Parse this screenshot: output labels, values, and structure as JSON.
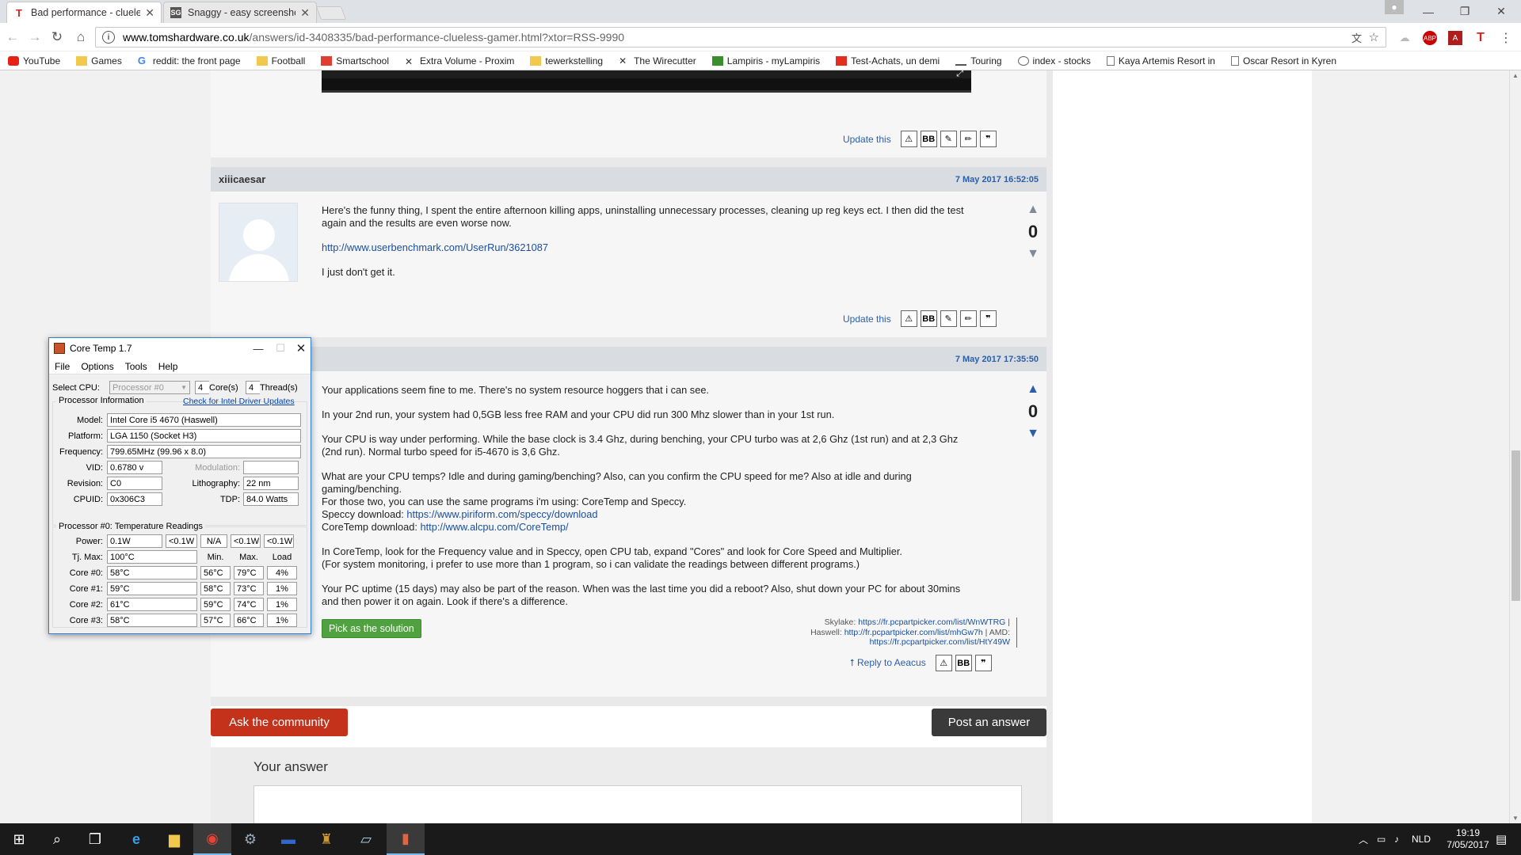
{
  "browser": {
    "tabs": [
      {
        "title": "Bad performance - clueless",
        "favicon": "T",
        "active": true
      },
      {
        "title": "Snaggy - easy screenshot",
        "favicon": "SG",
        "active": false
      }
    ],
    "url_host": "www.tomshardware.co.uk",
    "url_path": "/answers/id-3408335/bad-performance-clueless-gamer.html?xtor=RSS-9990",
    "bookmarks": [
      "YouTube",
      "Games",
      "reddit: the front page",
      "Football",
      "Smartschool",
      "Extra Volume - Proxim",
      "tewerkstelling",
      "The Wirecutter",
      "Lampiris - myLampiris",
      "Test-Achats, un demi",
      "Touring",
      "index - stocks",
      "Kaya Artemis Resort in",
      "Oscar Resort in Kyren"
    ]
  },
  "posts": {
    "first_actions": {
      "update": "Update this",
      "bb": "BB"
    },
    "xiiicaesar": {
      "user": "xiiicaesar",
      "date": "7 May 2017 16:52:05",
      "p1": "Here's the funny thing, I spent the entire afternoon killing apps, uninstalling unnecessary processes, cleaning up reg keys ect. I then did the test again and the results are even worse now.",
      "link": "http://www.userbenchmark.com/UserRun/3621087",
      "p3": "I just don't get it.",
      "votes": "0",
      "update": "Update this",
      "bb": "BB"
    },
    "aeacus": {
      "date": "7 May 2017 17:35:50",
      "p1": "Your applications seem fine to me. There's no system resource hoggers that i can see.",
      "p2": "In your 2nd run, your system had 0,5GB less free RAM and your CPU did run 300 Mhz slower than in your 1st run.",
      "p3": "Your CPU is way under performing. While the base clock is 3.4 Ghz, during benching, your CPU turbo was at 2,6 Ghz (1st run) and at 2,3 Ghz (2nd run). Normal turbo speed for i5-4670 is 3,6 Ghz.",
      "p4a": "What are your CPU temps? Idle and during gaming/benching? Also, can you confirm the CPU speed for me? Also at idle and during gaming/benching.",
      "p4b": "For those two, you can use the same programs i'm using: CoreTemp and Speccy.",
      "p4c": "Speccy download: ",
      "speccy_link": "https://www.piriform.com/speccy/download",
      "p4d": "CoreTemp download: ",
      "coretemp_link": "http://www.alcpu.com/CoreTemp/",
      "p5a": "In CoreTemp, look for the Frequency value and in Speccy, open CPU tab, expand \"Cores\" and look for Core Speed and Multiplier.",
      "p5b": "(For system monitoring, i prefer to use more than 1 program, so i can validate the readings between different programs.)",
      "p6": "Your PC uptime (15 days) may also be part of the reason. When was the last time you did a reboot? Also, shut down your PC for about 30mins and then power it on again. Look if there's a difference.",
      "votes": "0",
      "pick": "Pick as the solution",
      "sig_skylake_label": "Skylake: ",
      "sig_skylake": "https://fr.pcpartpicker.com/list/WnWTRG",
      "sig_haswell_label": "Haswell: ",
      "sig_haswell": "http://fr.pcpartpicker.com/list/mhGw7h",
      "sig_amd_label": " | AMD:",
      "sig_amd": "https://fr.pcpartpicker.com/list/HtY49W",
      "reply": "Reply to Aeacus",
      "bb": "BB"
    }
  },
  "buttons": {
    "ask": "Ask the community",
    "post": "Post an answer",
    "your_answer": "Your answer"
  },
  "coretemp": {
    "title": "Core Temp 1.7",
    "menu": [
      "File",
      "Options",
      "Tools",
      "Help"
    ],
    "select_cpu_label": "Select CPU:",
    "select_cpu": "Processor #0",
    "cores": "4",
    "cores_label": "Core(s)",
    "threads": "4",
    "threads_label": "Thread(s)",
    "proc_info": "Processor Information",
    "driver_link": "Check for Intel Driver Updates",
    "model_label": "Model:",
    "model": "Intel Core i5 4670 (Haswell)",
    "platform_label": "Platform:",
    "platform": "LGA 1150 (Socket H3)",
    "frequency_label": "Frequency:",
    "frequency": "799.65MHz (99.96 x 8.0)",
    "vid_label": "VID:",
    "vid": "0.6780 v",
    "modulation_label": "Modulation:",
    "revision_label": "Revision:",
    "revision": "C0",
    "lithography_label": "Lithography:",
    "lithography": "22 nm",
    "cpuid_label": "CPUID:",
    "cpuid": "0x306C3",
    "tdp_label": "TDP:",
    "tdp": "84.0 Watts",
    "temp_title": "Processor #0: Temperature Readings",
    "power_label": "Power:",
    "power": [
      "0.1W",
      "<0.1W",
      "N/A",
      "<0.1W",
      "<0.1W"
    ],
    "tjmax_label": "Tj. Max:",
    "tjmax": "100°C",
    "col_min": "Min.",
    "col_max": "Max.",
    "col_load": "Load",
    "cores_rows": [
      {
        "label": "Core #0:",
        "temp": "58°C",
        "min": "56°C",
        "max": "79°C",
        "load": "4%"
      },
      {
        "label": "Core #1:",
        "temp": "59°C",
        "min": "58°C",
        "max": "73°C",
        "load": "1%"
      },
      {
        "label": "Core #2:",
        "temp": "61°C",
        "min": "59°C",
        "max": "74°C",
        "load": "1%"
      },
      {
        "label": "Core #3:",
        "temp": "58°C",
        "min": "57°C",
        "max": "66°C",
        "load": "1%"
      }
    ]
  },
  "taskbar": {
    "lang": "NLD",
    "time": "19:19",
    "date": "7/05/2017"
  }
}
